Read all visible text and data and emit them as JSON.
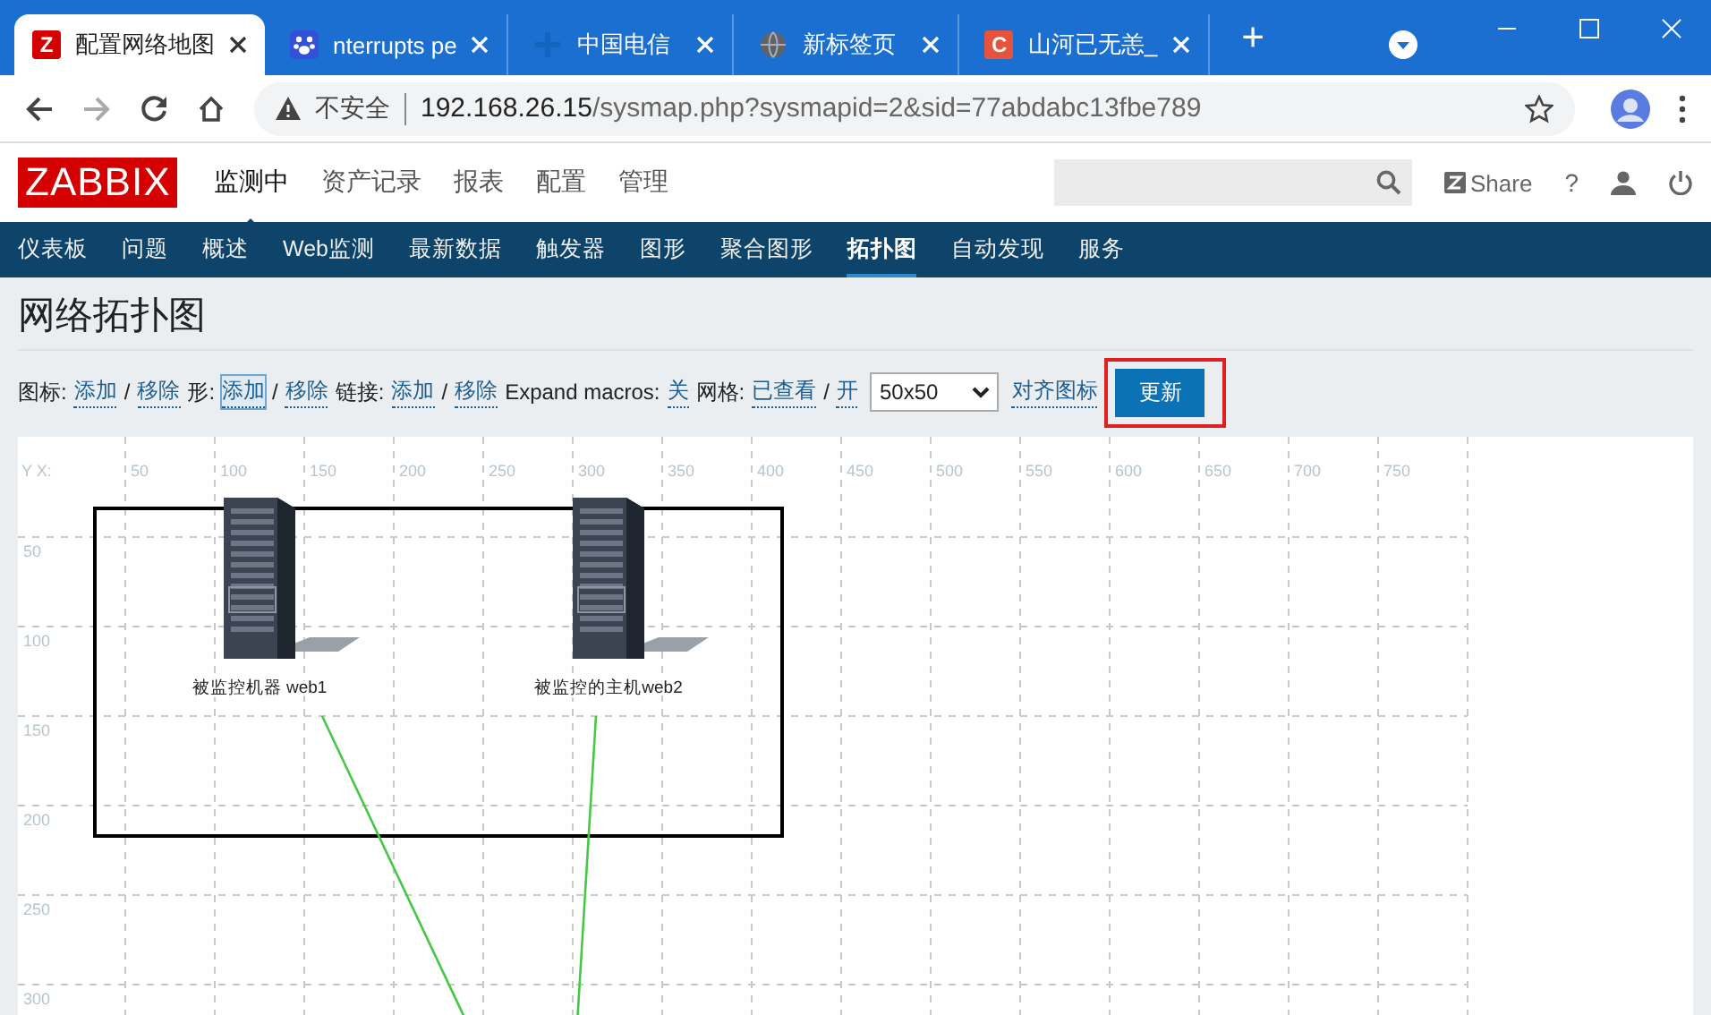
{
  "browser": {
    "tabs": [
      {
        "title": "配置网络地图",
        "selected": true,
        "kind": "letter",
        "favicon_letter": "Z",
        "color": "#d40000"
      },
      {
        "title": "nterrupts pe",
        "selected": false,
        "kind": "paw",
        "color": "#3450d8"
      },
      {
        "title": "中国电信",
        "selected": false,
        "kind": "cross",
        "color": "#1565c0"
      },
      {
        "title": "新标签页",
        "selected": false,
        "kind": "globe",
        "color": "#5f6368"
      },
      {
        "title": "山河已无恙_",
        "selected": false,
        "kind": "letter",
        "favicon_letter": "C",
        "color": "#e5533c"
      }
    ],
    "new_tab": "+",
    "security": "不安全",
    "url_host": "192.168.26.15",
    "url_path": "/sysmap.php?sysmapid=2&sid=77abdabc13fbe789"
  },
  "header": {
    "logo": "ZABBIX",
    "menu": [
      {
        "label": "监测中",
        "selected": true
      },
      {
        "label": "资产记录",
        "selected": false
      },
      {
        "label": "报表",
        "selected": false
      },
      {
        "label": "配置",
        "selected": false
      },
      {
        "label": "管理",
        "selected": false
      }
    ],
    "share": "Share",
    "help": "?"
  },
  "submenu": [
    {
      "label": "仪表板",
      "selected": false
    },
    {
      "label": "问题",
      "selected": false
    },
    {
      "label": "概述",
      "selected": false
    },
    {
      "label": "Web监测",
      "selected": false
    },
    {
      "label": "最新数据",
      "selected": false
    },
    {
      "label": "触发器",
      "selected": false
    },
    {
      "label": "图形",
      "selected": false
    },
    {
      "label": "聚合图形",
      "selected": false
    },
    {
      "label": "拓扑图",
      "selected": true
    },
    {
      "label": "自动发现",
      "selected": false
    },
    {
      "label": "服务",
      "selected": false
    }
  ],
  "page_title": "网络拓扑图",
  "controls": [
    {
      "kind": "label",
      "text": "图标:"
    },
    {
      "kind": "link",
      "text": "添加",
      "focused": false
    },
    {
      "kind": "sep",
      "text": "/"
    },
    {
      "kind": "link",
      "text": "移除",
      "focused": false
    },
    {
      "kind": "label",
      "text": "形:"
    },
    {
      "kind": "link",
      "text": "添加",
      "focused": true
    },
    {
      "kind": "sep",
      "text": "/"
    },
    {
      "kind": "link",
      "text": "移除",
      "focused": false
    },
    {
      "kind": "label",
      "text": "链接:"
    },
    {
      "kind": "link",
      "text": "添加",
      "focused": false
    },
    {
      "kind": "sep",
      "text": "/"
    },
    {
      "kind": "link",
      "text": "移除",
      "focused": false
    },
    {
      "kind": "label",
      "text": "Expand macros:"
    },
    {
      "kind": "link",
      "text": "关",
      "focused": false
    },
    {
      "kind": "label",
      "text": "网格:"
    },
    {
      "kind": "link",
      "text": "已查看",
      "focused": false
    },
    {
      "kind": "sep",
      "text": "/"
    },
    {
      "kind": "link",
      "text": "开",
      "focused": false
    },
    {
      "kind": "select",
      "text": "50x50"
    },
    {
      "kind": "link",
      "text": "对齐图标",
      "focused": false
    },
    {
      "kind": "button",
      "text": "更新",
      "highlighted": true
    }
  ],
  "map": {
    "corner_label": "Y X:",
    "x_labels": [
      "50",
      "100",
      "150",
      "200",
      "250",
      "300",
      "350",
      "400",
      "450",
      "500",
      "550",
      "600",
      "650",
      "700",
      "750"
    ],
    "y_labels": [
      "50",
      "100",
      "150",
      "200",
      "250",
      "300"
    ],
    "elements": [
      {
        "label": "被监控机器 web1"
      },
      {
        "label": "被监控的主机web2"
      }
    ],
    "shapes": [
      {
        "kind": "rectangle"
      }
    ],
    "links": [
      {
        "kind": "line"
      },
      {
        "kind": "line"
      }
    ]
  }
}
